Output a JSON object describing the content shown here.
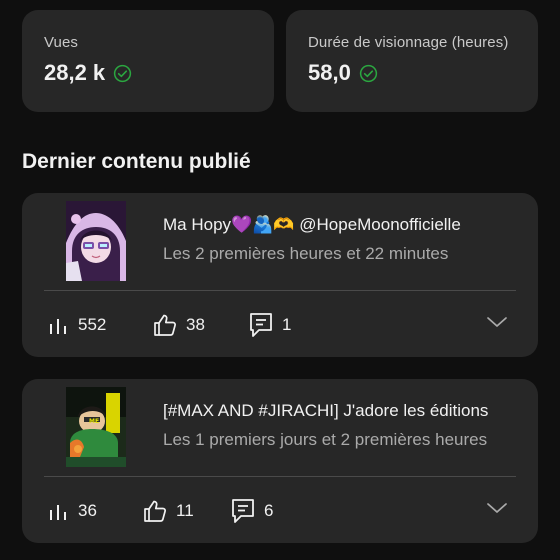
{
  "stats": [
    {
      "label": "Vues",
      "value": "28,2 k"
    },
    {
      "label": "Durée de visionnage (heures)",
      "value": "58,0"
    }
  ],
  "section_title": "Dernier contenu publié",
  "videos": [
    {
      "title": "Ma Hopy💜🫂🫶 @HopeMoonofficielle",
      "subtitle": "Les 2 premières heures et 22 minutes",
      "views": "552",
      "likes": "38",
      "comments": "1"
    },
    {
      "title": "[#MAX AND #JIRACHI] J'adore les éditions",
      "subtitle": "Les 1 premiers jours et 2 premières heures",
      "views": "36",
      "likes": "11",
      "comments": "6"
    }
  ],
  "icons": {
    "verified": "check-circle-icon",
    "views": "bar-chart-icon",
    "likes": "thumbs-up-icon",
    "comments": "comment-icon",
    "expand": "chevron-down-icon"
  },
  "colors": {
    "background": "#0f0f0f",
    "card": "#272727",
    "check": "#2ba640",
    "secondary_text": "#aaaaaa"
  }
}
